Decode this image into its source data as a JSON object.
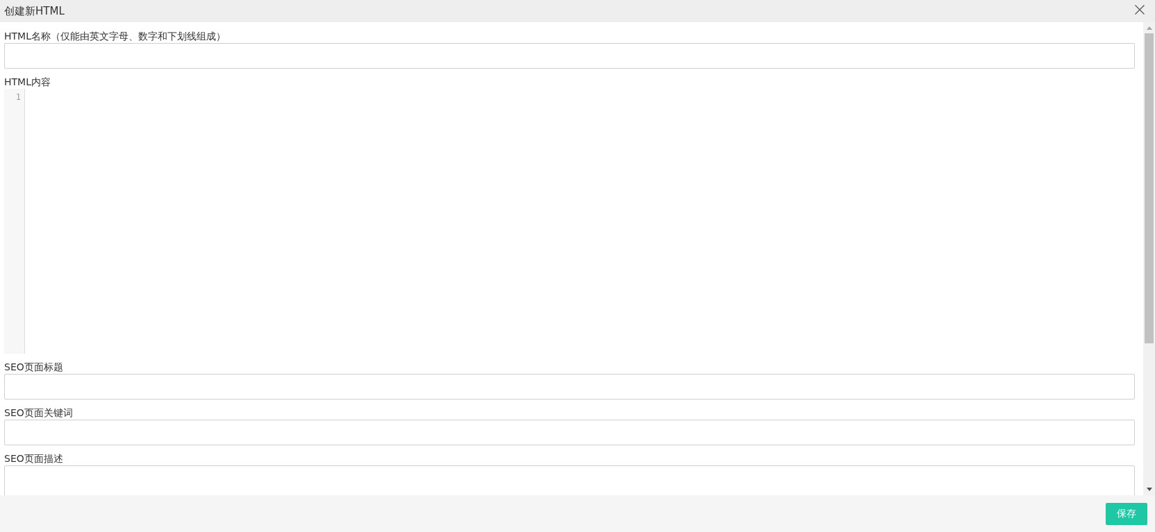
{
  "window": {
    "title": "创建新HTML"
  },
  "fields": [
    {
      "kind": "input",
      "label": "HTML名称（仅能由英文字母、数字和下划线组成）"
    },
    {
      "kind": "code",
      "label": "HTML内容",
      "line_numbers": [
        "1"
      ]
    },
    {
      "kind": "input",
      "label": "SEO页面标题"
    },
    {
      "kind": "input",
      "label": "SEO页面关键词"
    },
    {
      "kind": "textarea",
      "label": "SEO页面描述"
    }
  ],
  "buttons": [
    {
      "label": "保存"
    }
  ]
}
